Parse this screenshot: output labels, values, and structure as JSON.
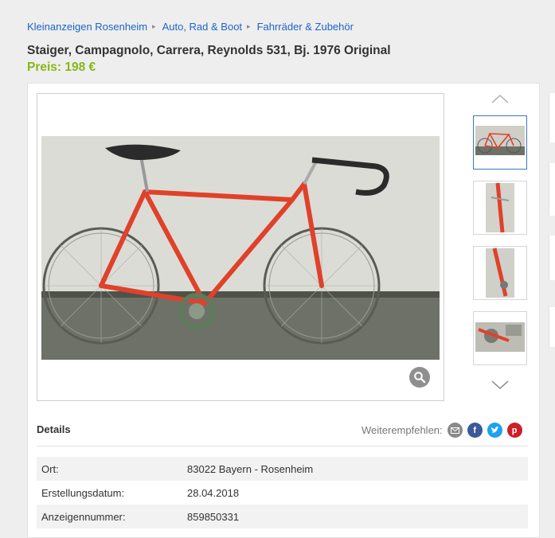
{
  "breadcrumb": {
    "items": [
      "Kleinanzeigen Rosenheim",
      "Auto, Rad & Boot",
      "Fahrräder & Zubehör"
    ],
    "separator": "▸"
  },
  "listing": {
    "title": "Staiger, Campagnolo, Carrera, Reynolds 531, Bj. 1976 Original",
    "price": "Preis: 198 €"
  },
  "gallery": {
    "up_icon": "chevron-up-icon",
    "down_icon": "chevron-down-icon",
    "zoom_icon": "magnifier-icon",
    "thumbnail_count": 4,
    "active_thumbnail": 0
  },
  "details": {
    "heading": "Details",
    "share_label": "Weiterempfehlen:",
    "share_icons": [
      "mail-icon",
      "facebook-icon",
      "twitter-icon",
      "pinterest-icon"
    ],
    "rows": [
      {
        "key": "Ort:",
        "value": "83022 Bayern - Rosenheim"
      },
      {
        "key": "Erstellungsdatum:",
        "value": "28.04.2018"
      },
      {
        "key": "Anzeigennummer:",
        "value": "859850331"
      }
    ]
  },
  "colors": {
    "link": "#1a66c7",
    "price": "#86b817",
    "mail": "#8a8a8a",
    "facebook": "#3b5998",
    "twitter": "#1da1f2",
    "pinterest": "#cb2027"
  }
}
